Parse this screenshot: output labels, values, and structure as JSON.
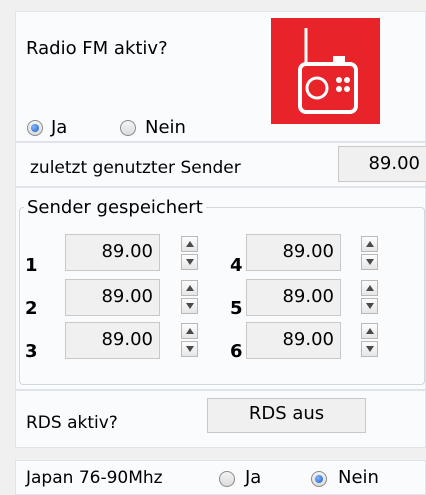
{
  "radio_fm": {
    "question": "Radio FM aktiv?",
    "options": [
      "Ja",
      "Nein"
    ],
    "selected": "Ja",
    "icon": "radio-icon",
    "icon_bg": "#e8242a"
  },
  "last_station": {
    "label": "zuletzt genutzter Sender",
    "value": "89.00"
  },
  "saved": {
    "title": "Sender gespeichert",
    "presets": [
      {
        "num": "1",
        "value": "89.00"
      },
      {
        "num": "2",
        "value": "89.00"
      },
      {
        "num": "3",
        "value": "89.00"
      },
      {
        "num": "4",
        "value": "89.00"
      },
      {
        "num": "5",
        "value": "89.00"
      },
      {
        "num": "6",
        "value": "89.00"
      }
    ]
  },
  "rds": {
    "label": "RDS aktiv?",
    "value": "RDS aus"
  },
  "japan": {
    "label": "Japan 76-90Mhz",
    "options": [
      "Ja",
      "Nein"
    ],
    "selected": "Nein"
  }
}
